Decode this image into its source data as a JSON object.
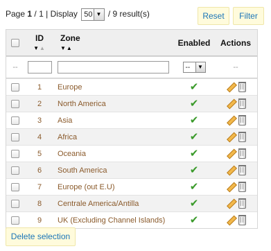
{
  "pager": {
    "page_word": "Page",
    "current_page": "1",
    "total_pages": "1",
    "display_word": "Display",
    "per_page": "50",
    "results": "/ 9 result(s)"
  },
  "toolbar": {
    "reset_label": "Reset",
    "filter_label": "Filter"
  },
  "headers": {
    "id": "ID",
    "zone": "Zone",
    "enabled": "Enabled",
    "actions": "Actions"
  },
  "filter_row": {
    "dash": "--",
    "enabled_select": "--",
    "actions_dash": "--"
  },
  "rows": [
    {
      "id": "1",
      "zone": "Europe",
      "enabled": true
    },
    {
      "id": "2",
      "zone": "North America",
      "enabled": true
    },
    {
      "id": "3",
      "zone": "Asia",
      "enabled": true
    },
    {
      "id": "4",
      "zone": "Africa",
      "enabled": true
    },
    {
      "id": "5",
      "zone": "Oceania",
      "enabled": true
    },
    {
      "id": "6",
      "zone": "South America",
      "enabled": true
    },
    {
      "id": "7",
      "zone": "Europe (out E.U)",
      "enabled": true
    },
    {
      "id": "8",
      "zone": "Centrale America/Antilla",
      "enabled": true
    },
    {
      "id": "9",
      "zone": "UK (Excluding Channel Islands)",
      "enabled": true
    }
  ],
  "icons": {
    "enabled": "check-icon",
    "edit": "pencil-icon",
    "delete": "trash-icon"
  },
  "footer": {
    "delete_selection_label": "Delete selection"
  },
  "colors": {
    "link": "#8a5a2b",
    "button_text": "#1a75b8",
    "button_bg": "#fffbdc",
    "check": "#3a9a2a"
  }
}
